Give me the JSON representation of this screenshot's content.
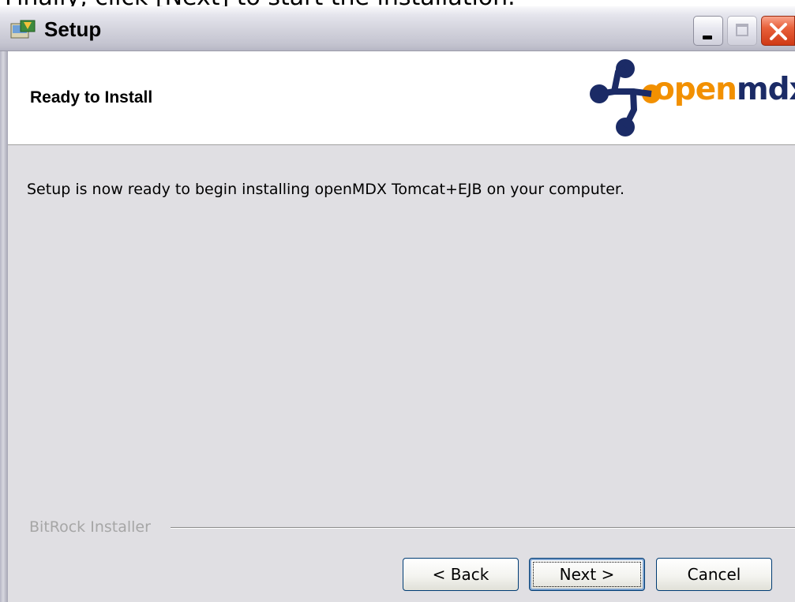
{
  "caption": "Finally, click [Next] to start the installation.",
  "window": {
    "title": "Setup",
    "icon": "setup-icon",
    "controls": [
      "minimize-icon",
      "maximize-icon",
      "close-icon"
    ]
  },
  "header": {
    "title": "Ready to Install",
    "logo": {
      "text_open": "open",
      "text_mdx": "mdx",
      "colors": {
        "open": "#f29000",
        "mdx": "#1b2b66"
      }
    }
  },
  "body": {
    "message": "Setup is now ready to begin installing openMDX Tomcat+EJB on your computer."
  },
  "footer": {
    "brand": "BitRock Installer",
    "buttons": {
      "back": "< Back",
      "next": "Next >",
      "cancel": "Cancel"
    }
  }
}
